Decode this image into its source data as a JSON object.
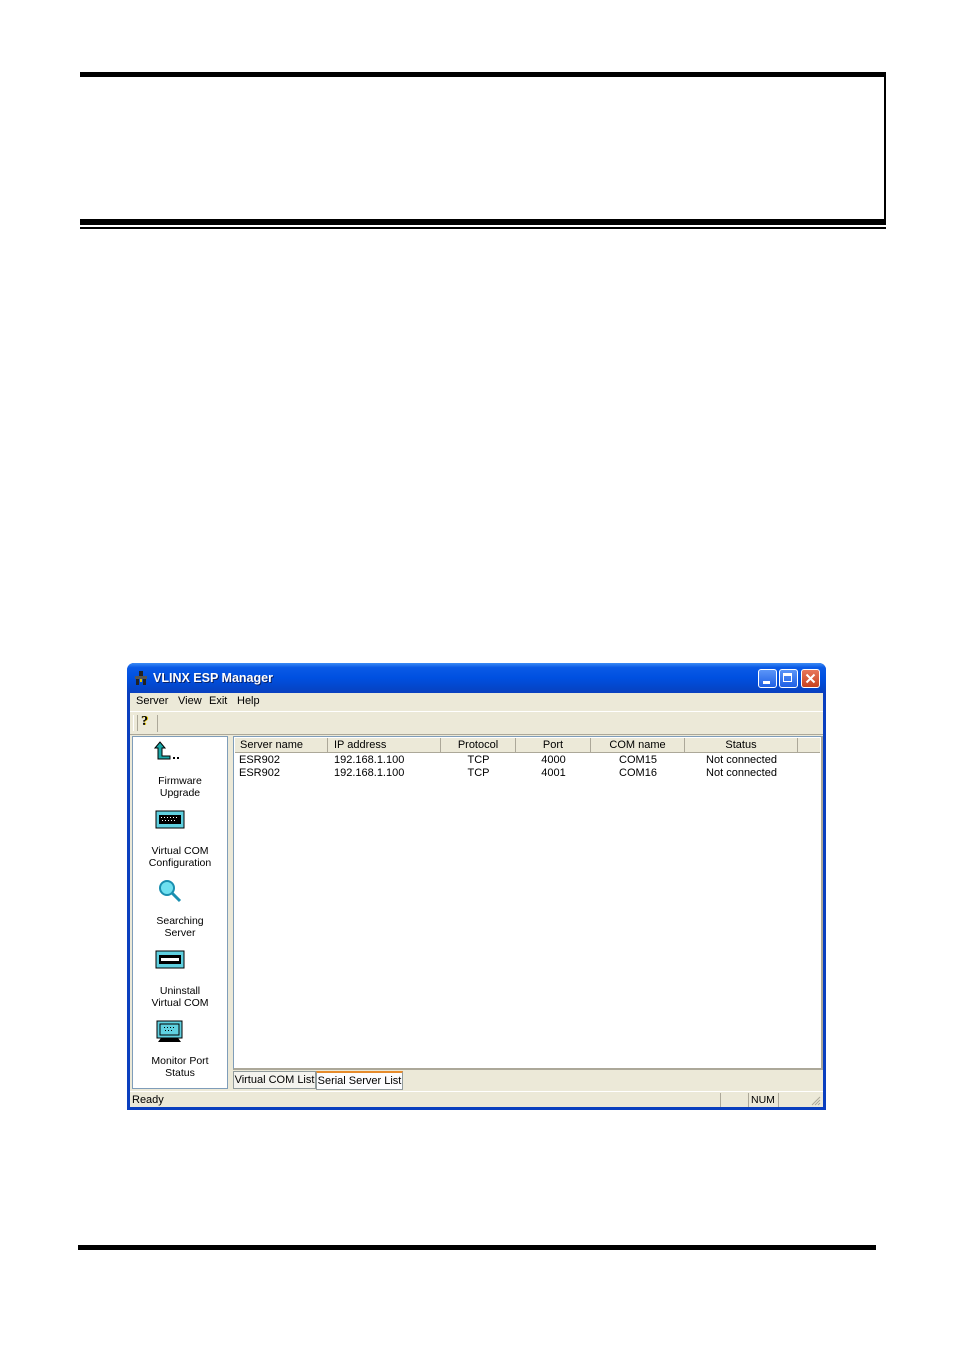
{
  "window": {
    "title": "VLINX ESP Manager",
    "menu": [
      "Server",
      "View",
      "Exit",
      "Help"
    ],
    "toolbar": {
      "help_glyph": "?"
    }
  },
  "shortcuts": [
    {
      "icon": "firmware-upgrade-icon",
      "label_line1": "Firmware",
      "label_line2": "Upgrade"
    },
    {
      "icon": "virtual-com-configuration-icon",
      "label_line1": "Virtual COM",
      "label_line2": "Configuration"
    },
    {
      "icon": "searching-server-icon",
      "label_line1": "Searching",
      "label_line2": "Server"
    },
    {
      "icon": "uninstall-virtual-com-icon",
      "label_line1": "Uninstall",
      "label_line2": "Virtual COM"
    },
    {
      "icon": "monitor-port-status-icon",
      "label_line1": "Monitor Port",
      "label_line2": "Status"
    }
  ],
  "table": {
    "columns": [
      "Server name",
      "IP address",
      "Protocol",
      "Port",
      "COM name",
      "Status"
    ],
    "rows": [
      [
        "ESR902",
        "192.168.1.100",
        "TCP",
        "4000",
        "COM15",
        "Not connected"
      ],
      [
        "ESR902",
        "192.168.1.100",
        "TCP",
        "4001",
        "COM16",
        "Not connected"
      ]
    ]
  },
  "tabs": [
    {
      "label": "Virtual COM List",
      "active": false
    },
    {
      "label": "Serial Server List",
      "active": true
    }
  ],
  "statusbar": {
    "text": "Ready",
    "num": "NUM"
  },
  "colors": {
    "title_bar": "#0050e0",
    "close_button": "#c7421f",
    "active_tab_accent": "#e68b2c"
  }
}
